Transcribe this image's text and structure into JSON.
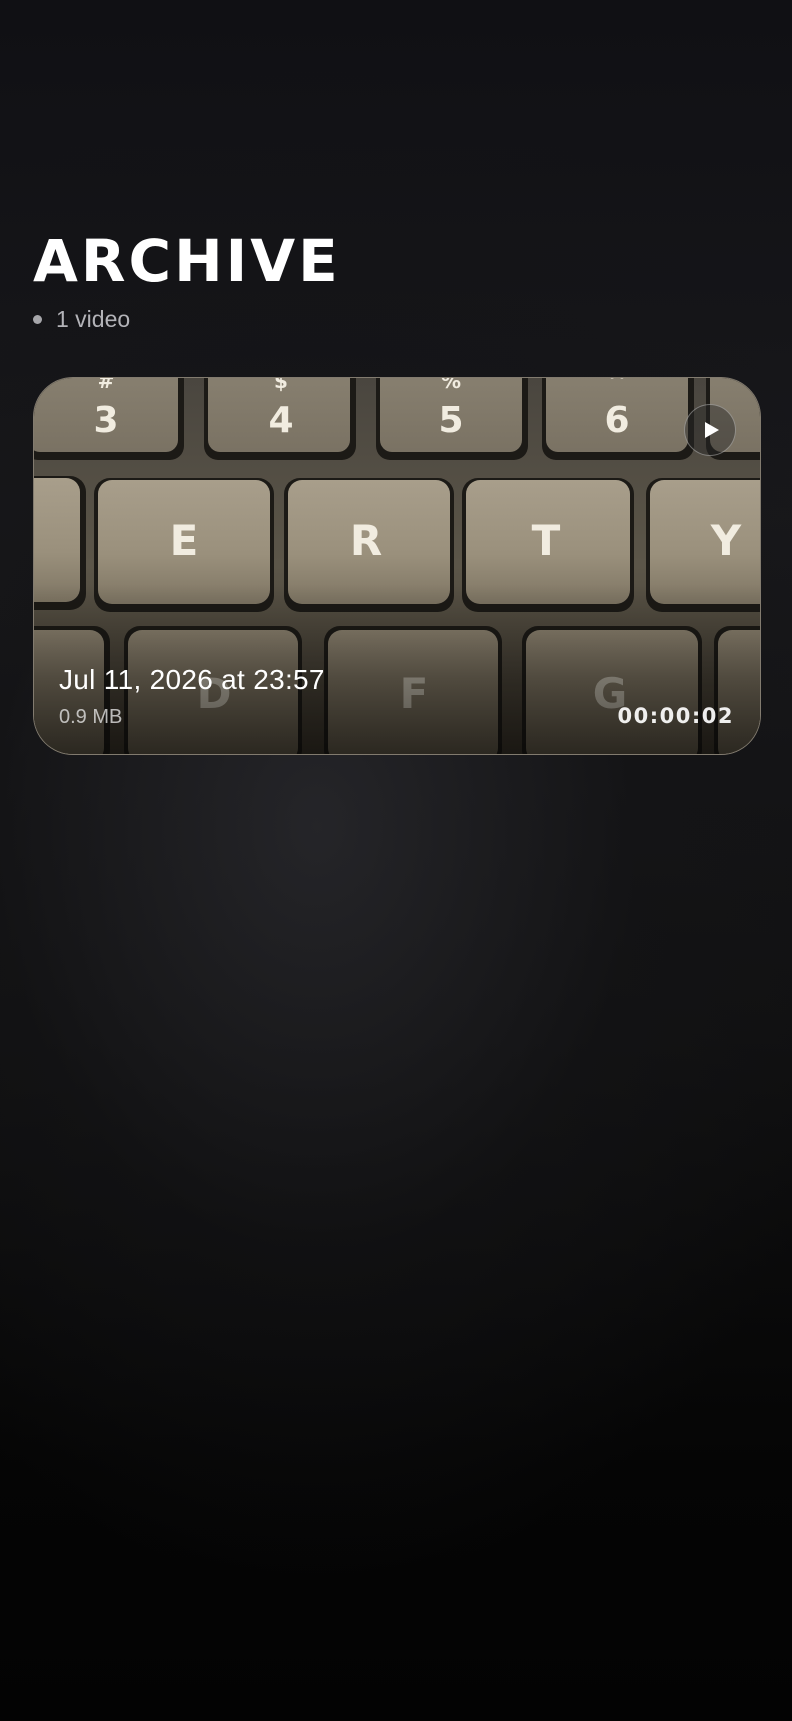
{
  "page": {
    "title": "ARCHIVE",
    "count_label": "1 video"
  },
  "videos": [
    {
      "date_label": "Jul 11, 2026 at 23:57",
      "size_label": "0.9 MB",
      "duration_label": "00:00:02",
      "thumbnail_key_labels": {
        "top_row": [
          "3",
          "4",
          "5",
          "6"
        ],
        "top_row_shift": [
          "#",
          "$",
          "%",
          "^"
        ],
        "middle_row": [
          "E",
          "R",
          "T",
          "Y"
        ],
        "bottom_row": [
          "D",
          "F",
          "G"
        ]
      }
    }
  ],
  "icons": {
    "play": "play-icon"
  },
  "colors": {
    "background": "#0c0c0e",
    "text_primary": "#ffffff",
    "text_secondary": "#b3b3b8"
  }
}
